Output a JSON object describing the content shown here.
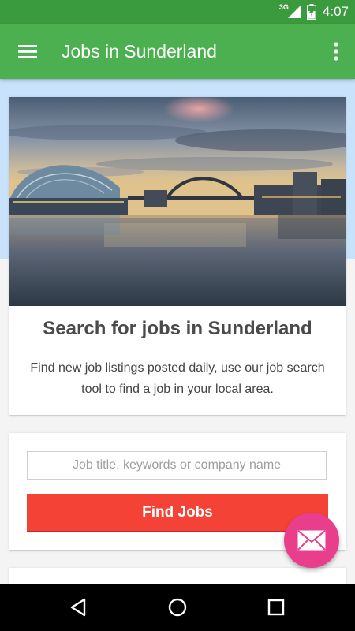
{
  "status_bar": {
    "network": "3G",
    "time": "4:07"
  },
  "app_bar": {
    "title": "Jobs in Sunderland",
    "menu_icon": "hamburger-menu-icon",
    "more_icon": "more-vertical-icon"
  },
  "hero": {
    "image": "city-river-bridge-photo",
    "title": "Search for jobs in Sunderland",
    "description": "Find new job listings posted daily, use our job search tool to find a job in your local area."
  },
  "search": {
    "placeholder": "Job title, keywords or company name",
    "value": "",
    "button_label": "Find Jobs"
  },
  "fab": {
    "icon": "mail-icon"
  },
  "nav": {
    "back_icon": "back-icon",
    "home_icon": "home-icon",
    "recents_icon": "recents-icon"
  },
  "colors": {
    "status_bar": "#3a9b3e",
    "app_bar": "#4caf50",
    "header_band": "#c9e2fb",
    "find_button": "#f44336",
    "fab": "#e83e8c"
  }
}
